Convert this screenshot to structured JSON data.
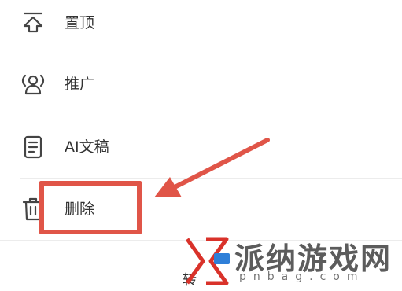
{
  "menu": {
    "items": [
      {
        "id": "pin",
        "label": "置顶",
        "icon": "pin-top-icon"
      },
      {
        "id": "promote",
        "label": "推广",
        "icon": "broadcast-user-icon"
      },
      {
        "id": "ai-draft",
        "label": "AI文稿",
        "icon": "document-icon"
      },
      {
        "id": "delete",
        "label": "删除",
        "icon": "trash-icon"
      }
    ]
  },
  "partial_text": "转",
  "watermark": {
    "text": "派纳游戏网",
    "url": "pnbag.com"
  },
  "colors": {
    "highlight": "#e05548",
    "text": "#333333",
    "divider": "#ececec"
  }
}
